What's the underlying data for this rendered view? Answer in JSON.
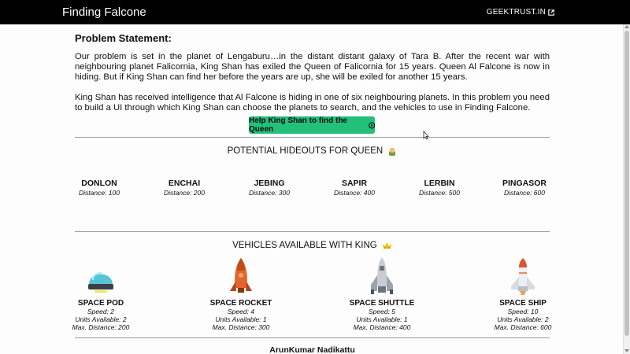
{
  "navbar": {
    "brand": "Finding Falcone",
    "link_label": "GEEKTRUST.IN",
    "link_icon": "external-link-icon"
  },
  "problem": {
    "title": "Problem Statement:",
    "paragraph1": "Our problem is set in the planet of Lengaburu…in the distant distant galaxy of Tara B. After the recent war with neighbouring planet Falicornia, King Shan has exiled the Queen of Falicornia for 15 years. Queen Al Falcone is now in hiding. But if King Shan can find her before the years are up, she will be exiled for another 15 years.",
    "paragraph2": "King Shan has received intelligence that Al Falcone is hiding in one of six neighbouring planets. In this problem you need to build a UI through which King Shan can choose the planets to search, and the vehicles to use in Finding Falcone.",
    "cta_label": "Help King Shan to find the Queen",
    "cta_icon": "play-circle-icon",
    "cta_color": "#22c07a"
  },
  "hideouts": {
    "title": "POTENTIAL HIDEOUTS FOR QUEEN",
    "title_icon": "queen-icon",
    "planets": [
      {
        "name": "DONLON",
        "distance": "Distance: 100"
      },
      {
        "name": "ENCHAI",
        "distance": "Distance: 200"
      },
      {
        "name": "JEBING",
        "distance": "Distance: 300"
      },
      {
        "name": "SAPIR",
        "distance": "Distance: 400"
      },
      {
        "name": "LERBIN",
        "distance": "Distance: 500"
      },
      {
        "name": "PINGASOR",
        "distance": "Distance: 600"
      }
    ]
  },
  "vehicles": {
    "title": "VEHICLES AVAILABLE WITH KING",
    "title_icon": "crown-icon",
    "items": [
      {
        "name": "SPACE POD",
        "speed": "Speed: 2",
        "units": "Units Available: 2",
        "max": "Max. Distance: 200",
        "icon": "space-pod-icon"
      },
      {
        "name": "SPACE ROCKET",
        "speed": "Speed: 4",
        "units": "Units Available: 1",
        "max": "Max. Distance: 300",
        "icon": "space-rocket-icon"
      },
      {
        "name": "SPACE SHUTTLE",
        "speed": "Speed: 5",
        "units": "Units Available: 1",
        "max": "Max. Distance: 400",
        "icon": "space-shuttle-icon"
      },
      {
        "name": "SPACE SHIP",
        "speed": "Speed: 10",
        "units": "Units Available: 2",
        "max": "Max. Distance: 600",
        "icon": "space-ship-icon"
      }
    ]
  },
  "footer": {
    "author": "ArunKumar Nadikattu"
  }
}
